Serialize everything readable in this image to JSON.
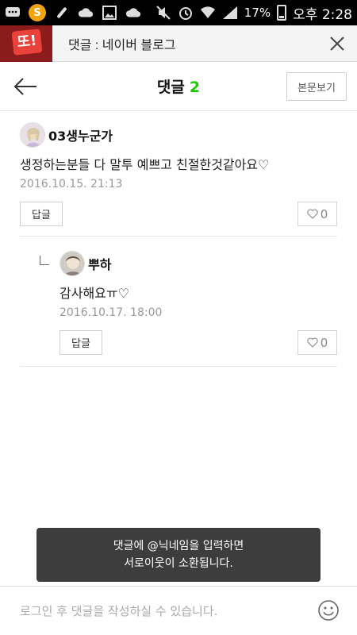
{
  "status_bar": {
    "battery": "17%",
    "time": "오후 2:28",
    "icons": [
      "message-icon",
      "s-badge-icon",
      "tool-icon",
      "cloud-icon",
      "image-icon",
      "cloud-icon",
      "mute-icon",
      "alarm-icon",
      "wifi-icon",
      "signal-icon",
      "battery-icon"
    ]
  },
  "browser": {
    "title": "댓글 : 네이버 블로그",
    "logo_text": "또!"
  },
  "header": {
    "title": "댓글",
    "count": "2",
    "body_button": "본문보기"
  },
  "comments": [
    {
      "author": "03생누군가",
      "text": "생정하는분들 다 말투 예쁘고 친절한것같아요♡",
      "date": "2016.10.15. 21:13",
      "reply_label": "답글",
      "likes": "0"
    },
    {
      "author": "뿌하",
      "text": "감사해요ㅠ♡",
      "date": "2016.10.17. 18:00",
      "reply_label": "답글",
      "likes": "0"
    }
  ],
  "toast": {
    "line1": "댓글에 @닉네임을 입력하면",
    "line2": "서로이웃이 소환됩니다."
  },
  "input": {
    "placeholder": "로그인 후 댓글을 작성하실 수 있습니다."
  },
  "colors": {
    "accent": "#1ec800",
    "toast_bg": "#3d3d3d"
  }
}
